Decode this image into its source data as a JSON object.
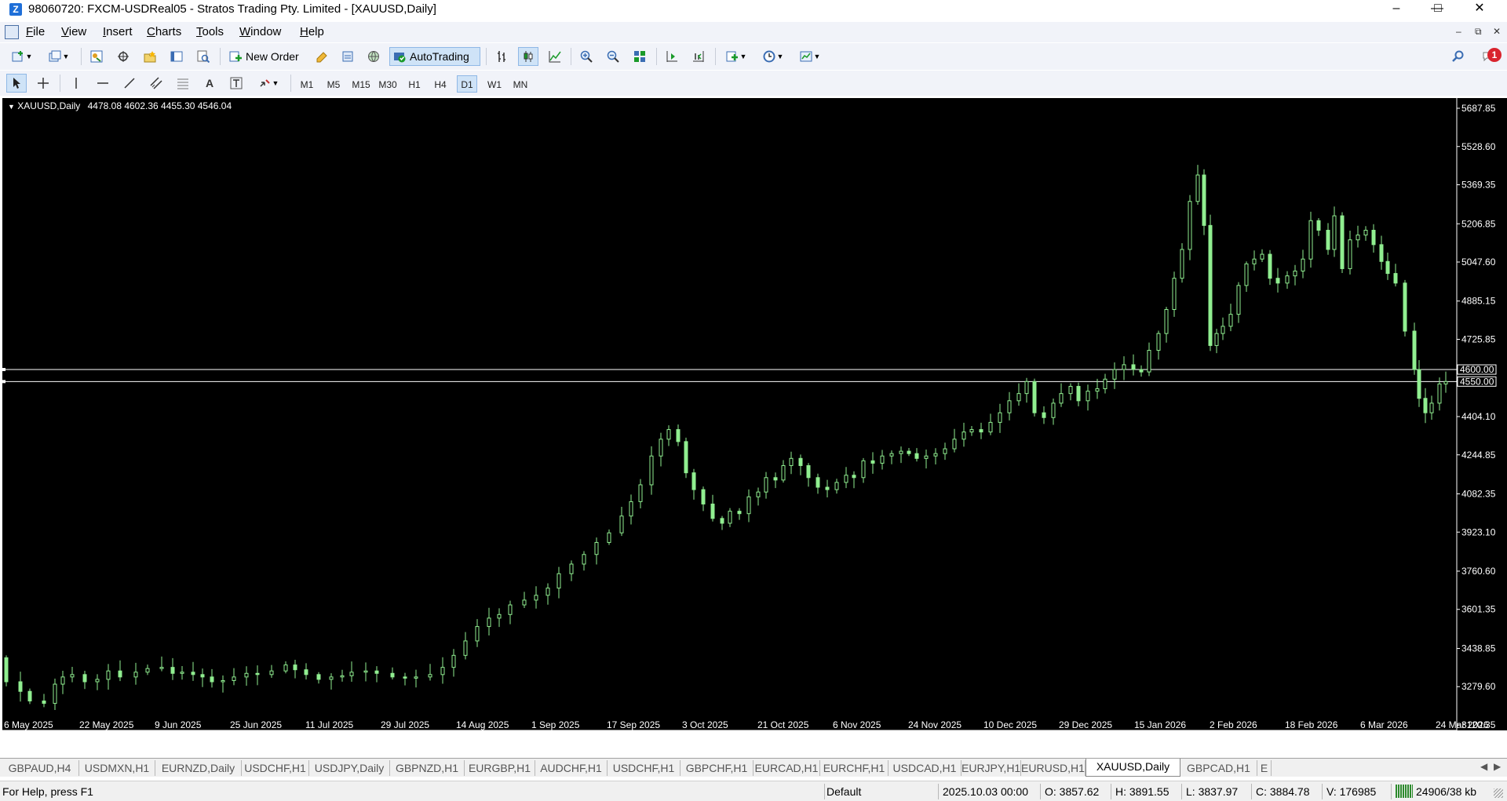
{
  "window": {
    "title": "98060720: FXCM-USDReal05 - Stratos Trading Pty. Limited - [XAUUSD,Daily]",
    "app_icon": "Z"
  },
  "menu": {
    "items": [
      "File",
      "View",
      "Insert",
      "Charts",
      "Tools",
      "Window",
      "Help"
    ]
  },
  "toolbar": {
    "new_order_label": "New Order",
    "autotrading_label": "AutoTrading",
    "timeframes": [
      "M1",
      "M5",
      "M15",
      "M30",
      "H1",
      "H4",
      "D1",
      "W1",
      "MN"
    ],
    "active_timeframe": "D1",
    "notification_count": "1"
  },
  "chart": {
    "symbol": "XAUUSD,Daily",
    "ohlc": "4478.08 4602.36 4455.30 4546.04",
    "price_ticks": [
      "5687.85",
      "5528.60",
      "5369.35",
      "5206.85",
      "5047.60",
      "4885.15",
      "4725.85",
      "4404.10",
      "4244.85",
      "4082.35",
      "3923.10",
      "3760.60",
      "3601.35",
      "3438.85",
      "3279.60",
      "3120.35"
    ],
    "hline_labels": [
      "4600.00",
      "4550.00"
    ],
    "date_ticks": [
      "6 May 2025",
      "22 May 2025",
      "9 Jun 2025",
      "25 Jun 2025",
      "11 Jul 2025",
      "29 Jul 2025",
      "14 Aug 2025",
      "1 Sep 2025",
      "17 Sep 2025",
      "3 Oct 2025",
      "21 Oct 2025",
      "6 Nov 2025",
      "24 Nov 2025",
      "10 Dec 2025",
      "29 Dec 2025",
      "15 Jan 2026",
      "2 Feb 2026",
      "18 Feb 2026",
      "6 Mar 2026",
      "24 Mar 2026"
    ],
    "colors": {
      "background": "#000000",
      "candle": "#90ee90",
      "text": "#ffffff",
      "hline": "#ffffff"
    }
  },
  "tabs": [
    "GBPAUD,H4",
    "USDMXN,H1",
    "EURNZD,Daily",
    "USDCHF,H1",
    "USDJPY,Daily",
    "GBPNZD,H1",
    "EURGBP,H1",
    "AUDCHF,H1",
    "USDCHF,H1",
    "GBPCHF,H1",
    "EURCAD,H1",
    "EURCHF,H1",
    "USDCAD,H1",
    "EURJPY,H1",
    "EURUSD,H1",
    "XAUUSD,Daily",
    "GBPCAD,H1",
    "E"
  ],
  "active_tab": "XAUUSD,Daily",
  "status": {
    "help": "For Help, press F1",
    "profile": "Default",
    "time": "2025.10.03 00:00",
    "open": "O: 3857.62",
    "high": "H: 3891.55",
    "low": "L: 3837.97",
    "close": "C: 3884.78",
    "volume": "V: 176985",
    "traffic": "24906/38 kb"
  }
}
